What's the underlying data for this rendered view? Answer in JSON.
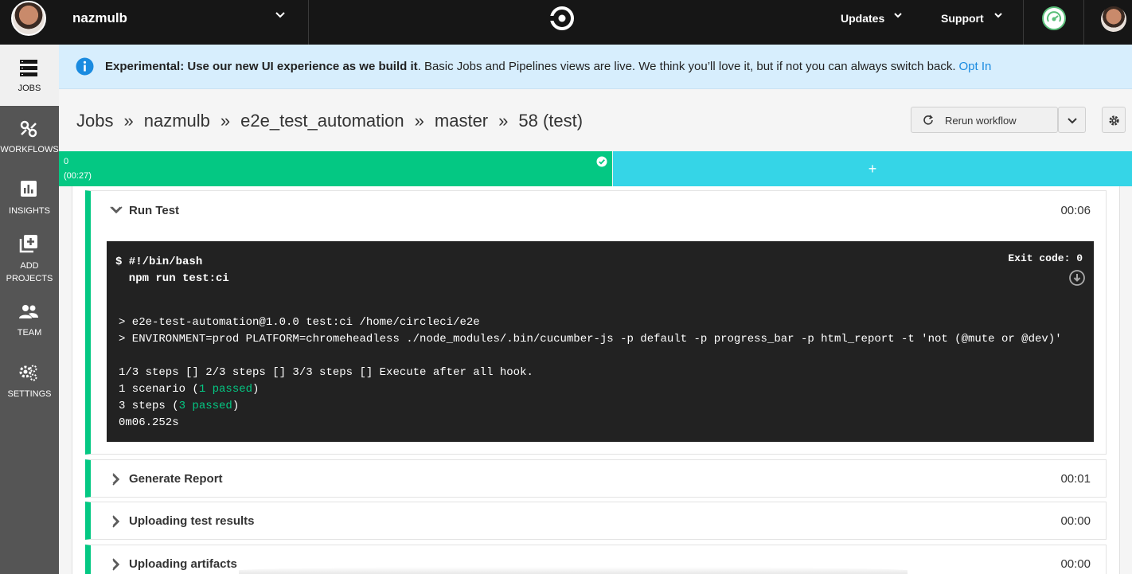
{
  "topbar": {
    "org_name": "nazmulb",
    "menus": [
      {
        "label": "Updates"
      },
      {
        "label": "Support"
      }
    ]
  },
  "sidebar": {
    "items": [
      {
        "label": "JOBS",
        "icon": "jobs-icon",
        "active": true
      },
      {
        "label": "WORKFLOWS",
        "icon": "workflows-icon"
      },
      {
        "label": "INSIGHTS",
        "icon": "insights-icon"
      },
      {
        "label": "ADD",
        "label2": "PROJECTS",
        "icon": "add-projects-icon"
      },
      {
        "label": "TEAM",
        "icon": "team-icon"
      },
      {
        "label": "SETTINGS",
        "icon": "settings-icon"
      }
    ]
  },
  "banner": {
    "bold": "Experimental: Use our new UI experience as we build it",
    "text": ". Basic Jobs and Pipelines views are live. We think you’ll love it, but if not you can always switch back.",
    "link": "Opt In"
  },
  "breadcrumb": {
    "items": [
      "Jobs",
      "nazmulb",
      "e2e_test_automation",
      "master",
      "58 (test)"
    ],
    "separator": "»"
  },
  "actions": {
    "rerun_label": "Rerun workflow"
  },
  "parallel": {
    "run_index": "0",
    "run_duration": "(00:27)",
    "add_label": "+"
  },
  "steps": [
    {
      "name": "Run Test",
      "time": "00:06",
      "expanded": true
    },
    {
      "name": "Generate Report",
      "time": "00:01"
    },
    {
      "name": "Uploading test results",
      "time": "00:00"
    },
    {
      "name": "Uploading artifacts",
      "time": "00:00"
    }
  ],
  "terminal": {
    "cmd_line1": "$ #!/bin/bash",
    "cmd_line2": "  npm run test:ci",
    "exit_code": "Exit code: 0",
    "out_line1": "> e2e-test-automation@1.0.0 test:ci /home/circleci/e2e",
    "out_line2": "> ENVIRONMENT=prod PLATFORM=chromeheadless ./node_modules/.bin/cucumber-js -p default -p progress_bar -p html_report -t 'not (@mute or @dev)'",
    "out_line3": "1/3 steps [] 2/3 steps [] 3/3 steps [] Execute after all hook.",
    "scenario_prefix": "1 scenario (",
    "scenario_pass": "1 passed",
    "steps_prefix": "3 steps (",
    "steps_pass": "3 passed",
    "close_paren": ")",
    "out_time": "0m06.252s"
  },
  "colors": {
    "success": "#04c883",
    "accent": "#35d5e7",
    "link": "#1a8be0"
  }
}
